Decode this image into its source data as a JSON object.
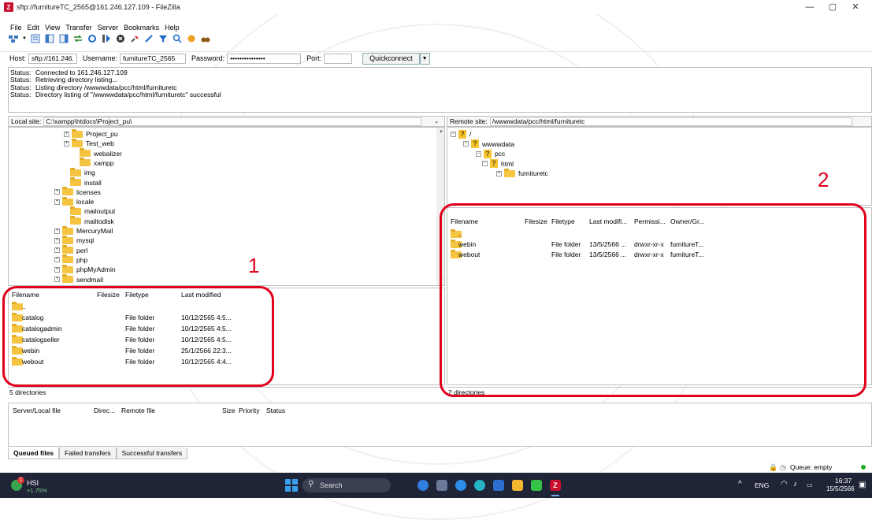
{
  "window": {
    "title": "sftp://furnitureTC_2565@161.246.127.109 - FileZilla",
    "icon_letter": "Z",
    "controls": [
      "—",
      "▢",
      "✕"
    ]
  },
  "menu": [
    "File",
    "Edit",
    "View",
    "Transfer",
    "Server",
    "Bookmarks",
    "Help"
  ],
  "toolbar_icons": [
    "site-manager-icon",
    "dropdown-icon",
    "toggle-log-icon",
    "toggle-local-tree-icon",
    "toggle-remote-tree-icon",
    "toggle-queue-icon",
    "refresh-icon",
    "process-queue-icon",
    "cancel-icon",
    "disconnect-icon",
    "reconnect-icon",
    "filter-icon",
    "search-icon",
    "compare-icon",
    "binoculars-icon"
  ],
  "quickconnect": {
    "host_label": "Host:",
    "host_value": "sftp://161.246.127",
    "user_label": "Username:",
    "user_value": "furnitureTC_2565",
    "pass_label": "Password:",
    "pass_value": "•••••••••••••••",
    "port_label": "Port:",
    "port_value": "",
    "button": "Quickconnect",
    "dropdown": "▼"
  },
  "log": [
    {
      "k": "Status:",
      "v": "Connected to 161.246.127.109"
    },
    {
      "k": "Status:",
      "v": "Retrieving directory listing..."
    },
    {
      "k": "Status:",
      "v": "Listing directory /wwwwdata/pcc/html/furnituretc"
    },
    {
      "k": "Status:",
      "v": "Directory listing of \"/wwwwdata/pcc/html/furnituretc\" successful"
    }
  ],
  "local": {
    "site_label": "Local site:",
    "site_path": "C:\\xampp\\htdocs\\Project_pu\\",
    "tree": [
      "Project_pu",
      "Test_web",
      "webalizer",
      "xampp",
      "img",
      "install",
      "licenses",
      "locale",
      "mailoutput",
      "mailtodisk",
      "MercuryMail",
      "mysql",
      "perl",
      "php",
      "phpMyAdmin",
      "sendmail"
    ],
    "headers": {
      "name": "Filename",
      "size": "Filesize",
      "type": "Filetype",
      "modified": "Last modified"
    },
    "files": [
      {
        "name": "..",
        "type": "",
        "modified": ""
      },
      {
        "name": "catalog",
        "type": "File folder",
        "modified": "10/12/2565 4:5..."
      },
      {
        "name": "catalogadmin",
        "type": "File folder",
        "modified": "10/12/2565 4:5..."
      },
      {
        "name": "catalogseller",
        "type": "File folder",
        "modified": "10/12/2565 4:5..."
      },
      {
        "name": "webin",
        "type": "File folder",
        "modified": "25/1/2566 22:3..."
      },
      {
        "name": "webout",
        "type": "File folder",
        "modified": "10/12/2565 4:4..."
      }
    ],
    "status": "5 directories",
    "annotation": "1"
  },
  "remote": {
    "site_label": "Remote site:",
    "site_path": "/wwwwdata/pcc/html/furnituretc",
    "tree": [
      "/",
      "wwwwdata",
      "pcc",
      "html",
      "furnituretc"
    ],
    "headers": {
      "name": "Filename",
      "size": "Filesize",
      "type": "Filetype",
      "modified": "Last modifi...",
      "perm": "Permissi...",
      "owner": "Owner/Gr..."
    },
    "files": [
      {
        "name": "..",
        "type": "",
        "modified": "",
        "perm": "",
        "owner": ""
      },
      {
        "name": "webin",
        "type": "File folder",
        "modified": "13/5/2566 ...",
        "perm": "drwxr-xr-x",
        "owner": "furnitureT..."
      },
      {
        "name": "webout",
        "type": "File folder",
        "modified": "13/5/2566 ...",
        "perm": "drwxr-xr-x",
        "owner": "furnitureT..."
      }
    ],
    "status": "2 directories",
    "annotation": "2"
  },
  "queue": {
    "headers": [
      "Server/Local file",
      "Direc...",
      "Remote file",
      "Size",
      "Priority",
      "Status"
    ],
    "tabs": [
      "Queued files",
      "Failed transfers",
      "Successful transfers"
    ]
  },
  "statusbar": {
    "queue": "Queue: empty"
  },
  "taskbar": {
    "weather_name": "HSI",
    "weather_change": "+1.75%",
    "badge": "1",
    "search": "Search",
    "lang": "ENG",
    "time": "16:37",
    "date": "15/5/2566",
    "up_arrow": "^"
  },
  "colors": {
    "annotation": "#e0001b",
    "taskbar": "#1f2437",
    "folder": "#f5c542"
  }
}
